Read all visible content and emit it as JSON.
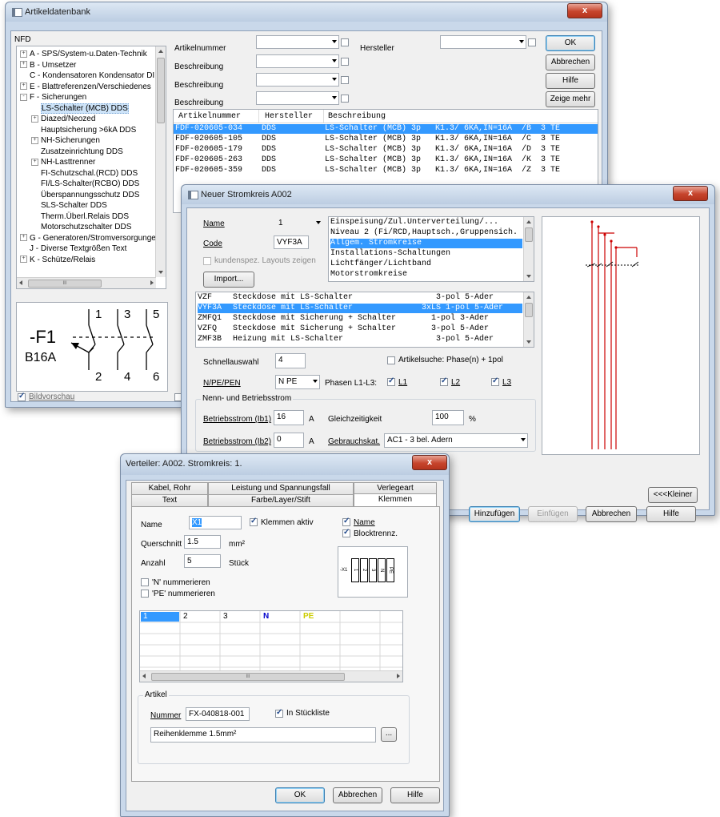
{
  "w1": {
    "title": "Artikeldatenbank",
    "close": "x",
    "tree_title": "NFD",
    "tree": [
      {
        "label": "A - SPS/System-u.Daten-Technik",
        "pm": "+"
      },
      {
        "label": "B - Umsetzer",
        "pm": "+"
      },
      {
        "label": "C - Kondensatoren Kondensator DI",
        "pm": ""
      },
      {
        "label": "E - Blattreferenzen/Verschiedenes",
        "pm": "+"
      },
      {
        "label": "F - Sicherungen",
        "pm": "-"
      },
      {
        "label": "LS-Schalter (MCB) DDS",
        "pm": ""
      },
      {
        "label": "Diazed/Neozed",
        "pm": "+"
      },
      {
        "label": "Hauptsicherung >6kA DDS",
        "pm": ""
      },
      {
        "label": "NH-Sicherungen",
        "pm": "+"
      },
      {
        "label": "Zusatzeinrichtung DDS",
        "pm": ""
      },
      {
        "label": "NH-Lasttrenner",
        "pm": "+"
      },
      {
        "label": "FI-Schutzschal.(RCD) DDS",
        "pm": ""
      },
      {
        "label": "FI/LS-Schalter(RCBO) DDS",
        "pm": ""
      },
      {
        "label": "Überspannungsschutz DDS",
        "pm": ""
      },
      {
        "label": "SLS-Schalter DDS",
        "pm": ""
      },
      {
        "label": "Therm.Überl.Relais DDS",
        "pm": ""
      },
      {
        "label": "Motorschutzschalter DDS",
        "pm": ""
      },
      {
        "label": "G - Generatoren/Stromversorgunge",
        "pm": "+"
      },
      {
        "label": "J - Diverse Textgrößen Text",
        "pm": ""
      },
      {
        "label": "K - Schütze/Relais",
        "pm": "+"
      }
    ],
    "hscroll_mark": "III",
    "preview": {
      "ref": "-F1",
      "type": "B16A",
      "top_pins": [
        "1",
        "3",
        "5"
      ],
      "bottom_pins": [
        "2",
        "4",
        "6"
      ]
    },
    "bildvorschau": "Bildvorschau",
    "bildvorschau_checked": true,
    "search_rows": [
      {
        "label": "Artikelnummer",
        "value": ""
      },
      {
        "label": "Beschreibung",
        "value": ""
      },
      {
        "label": "Beschreibung",
        "value": ""
      },
      {
        "label": "Beschreibung",
        "value": ""
      }
    ],
    "hersteller_label": "Hersteller",
    "buttons": {
      "ok": "OK",
      "abbrechen": "Abbrechen",
      "hilfe": "Hilfe",
      "zeige_mehr": "Zeige mehr"
    },
    "results_headers": [
      "Artikelnummer",
      "Hersteller",
      "Beschreibung"
    ],
    "results": [
      {
        "nr": "FDF-020605-034",
        "hersteller": "DDS",
        "desc": "LS-Schalter (MCB) 3p   K1.3/ 6KA,IN=16A  /B  3 TE",
        "selected": true
      },
      {
        "nr": "FDF-020605-105",
        "hersteller": "DDS",
        "desc": "LS-Schalter (MCB) 3p   K1.3/ 6KA,IN=16A  /C  3 TE",
        "selected": false
      },
      {
        "nr": "FDF-020605-179",
        "hersteller": "DDS",
        "desc": "LS-Schalter (MCB) 3p   K1.3/ 6KA,IN=16A  /D  3 TE",
        "selected": false
      },
      {
        "nr": "FDF-020605-263",
        "hersteller": "DDS",
        "desc": "LS-Schalter (MCB) 3p   K1.3/ 6KA,IN=16A  /K  3 TE",
        "selected": false
      },
      {
        "nr": "FDF-020605-359",
        "hersteller": "DDS",
        "desc": "LS-Schalter (MCB) 3p   K1.3/ 6KA,IN=16A  /Z  3 TE",
        "selected": false
      }
    ],
    "partial_label": "N"
  },
  "w2": {
    "title": "Neuer Stromkreis  A002",
    "close": "x",
    "name_label": "Name",
    "name_value": "1",
    "code_label": "Code",
    "code_value": "VYF3A",
    "kundenspez": "kundenspez. Layouts zeigen",
    "import": "Import...",
    "categories": [
      {
        "text": "Einspeisung/Zul.Unterverteilung/...",
        "selected": false
      },
      {
        "text": "Niveau 2 (Fi/RCD,Hauptsch.,Gruppensich.",
        "selected": false
      },
      {
        "text": "Allgem. Stromkreise",
        "selected": true
      },
      {
        "text": "Installations-Schaltungen",
        "selected": false
      },
      {
        "text": "Lichtfänger/Lichtband",
        "selected": false
      },
      {
        "text": "Motorstromkreise",
        "selected": false
      }
    ],
    "circuits": [
      {
        "code": "VZF   ",
        "desc": "Steckdose mit LS-Schalter       ",
        "poles": "   3-pol 5-Ader",
        "selected": false
      },
      {
        "code": "VYF3A ",
        "desc": "Steckdose mit LS-Schalter       ",
        "poles": "3xLS 1-pol 5-Ader",
        "selected": true
      },
      {
        "code": "ZMFQ1 ",
        "desc": "Steckdose mit Sicherung + Schalter",
        "poles": "  1-pol 3-Ader",
        "selected": false
      },
      {
        "code": "VZFQ  ",
        "desc": "Steckdose mit Sicherung + Schalter",
        "poles": "  3-pol 5-Ader",
        "selected": false
      },
      {
        "code": "ZMF3B ",
        "desc": "Heizung mit LS-Schalter         ",
        "poles": "   3-pol 5-Ader",
        "selected": false
      }
    ],
    "schnell_label": "Schnellauswahl",
    "schnell_value": "4",
    "artikelsuche": "Artikelsuche: Phase(n) + 1pol",
    "npe_label": "N/PE/PEN",
    "npe_value": "N PE",
    "phasen_label": "Phasen L1-L3:",
    "phases": [
      "L1",
      "L2",
      "L3"
    ],
    "nenn_group": "Nenn- und Betriebsstrom",
    "ib1_label": "Betriebsstrom (Ib1)",
    "ib1_value": "16",
    "ib2_label": "Betriebsstrom (Ib2)",
    "ib2_value": "0",
    "unit_a": "A",
    "gleich_label": "Gleichzeitigkeit",
    "gleich_value": "100",
    "percent": "%",
    "gebrauch_label": "Gebrauchskat.",
    "gebrauch_value": "AC1 - 3 bel. Adern",
    "kleiner": "<<<Kleiner",
    "buttons": {
      "hinzufuegen": "Hinzufügen",
      "einfuegen": "Einfügen",
      "abbrechen": "Abbrechen",
      "hilfe": "Hilfe"
    }
  },
  "w3": {
    "title": "Verteiler: A002. Stromkreis: 1.",
    "close": "x",
    "tabs_back": [
      "Kabel, Rohr",
      "Leistung und Spannungsfall",
      "Verlegeart"
    ],
    "tabs_front": [
      "Text",
      "Farbe/Layer/Stift",
      "Klemmen"
    ],
    "name_label": "Name",
    "name_value": "X1",
    "klemmen_aktiv": "Klemmen aktiv",
    "quer_label": "Querschnitt",
    "quer_value": "1.5",
    "quer_unit": "mm²",
    "anzahl_label": "Anzahl",
    "anzahl_value": "5",
    "anzahl_unit": "Stück",
    "chk_name": "Name",
    "chk_block": "Blocktrennz.",
    "preview_label": "-X1",
    "preview_cells": [
      "1",
      "2",
      "3",
      "N",
      "PE"
    ],
    "n_numm": "'N' nummerieren",
    "pe_numm": "'PE' nummerieren",
    "grid": [
      {
        "text": "1",
        "color": "#ffffff",
        "bg": "#3399ff"
      },
      {
        "text": "2",
        "color": "#000000",
        "bg": ""
      },
      {
        "text": "3",
        "color": "#000000",
        "bg": ""
      },
      {
        "text": "N",
        "color": "#0000cc",
        "bg": ""
      },
      {
        "text": "PE",
        "color": "#cccc00",
        "bg": ""
      }
    ],
    "hscroll_mark": "III",
    "artikel_group": "Artikel",
    "nummer_label": "Nummer",
    "nummer_value": "FX-040818-001",
    "in_stueckliste": "In Stückliste",
    "desc_value": "Reihenklemme      1.5mm²",
    "dots": "...",
    "buttons": {
      "ok": "OK",
      "abbrechen": "Abbrechen",
      "hilfe": "Hilfe"
    }
  }
}
